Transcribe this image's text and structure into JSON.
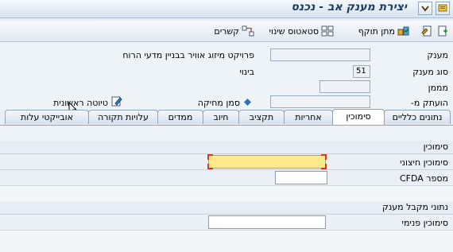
{
  "window": {
    "title": "יצירת מענק אב - נכנס"
  },
  "toolbar": {
    "items": [
      {
        "label": ""
      },
      {
        "label": ""
      },
      {
        "label": "מתן תוקף"
      },
      {
        "label": "סטאטוס שינוי"
      },
      {
        "label": "קשרים"
      }
    ]
  },
  "header": {
    "grant_label": "מענק",
    "grant_desc": "פרויקט מיזוג אוויר בבניין מדעי הרוח",
    "grant_type_label": "סוג מענק",
    "grant_type_value": "51",
    "grant_type_desc": "בינוי",
    "funder_label": "מממן",
    "copied_from_label": "הועתק מ-",
    "delete_flag_label": "סמן מחיקה",
    "draft_label": "טיוטה ראשונית"
  },
  "tabs": [
    "נתונים כלליים",
    "סימוכין",
    "אחריות",
    "תקציב",
    "חיוב",
    "ממדים",
    "עלויות תקורה",
    "אובייקטי עלות"
  ],
  "references": {
    "group_title": "סימוכין",
    "external_ref_label": "סימוכין חיצוני",
    "external_ref_value": "",
    "cfda_label": "מספר CFDA",
    "cfda_value": ""
  },
  "recipient": {
    "group_title": "נתוני מקבל מענק",
    "internal_ref_label": "סימוכין פנימי",
    "internal_ref_value": ""
  }
}
